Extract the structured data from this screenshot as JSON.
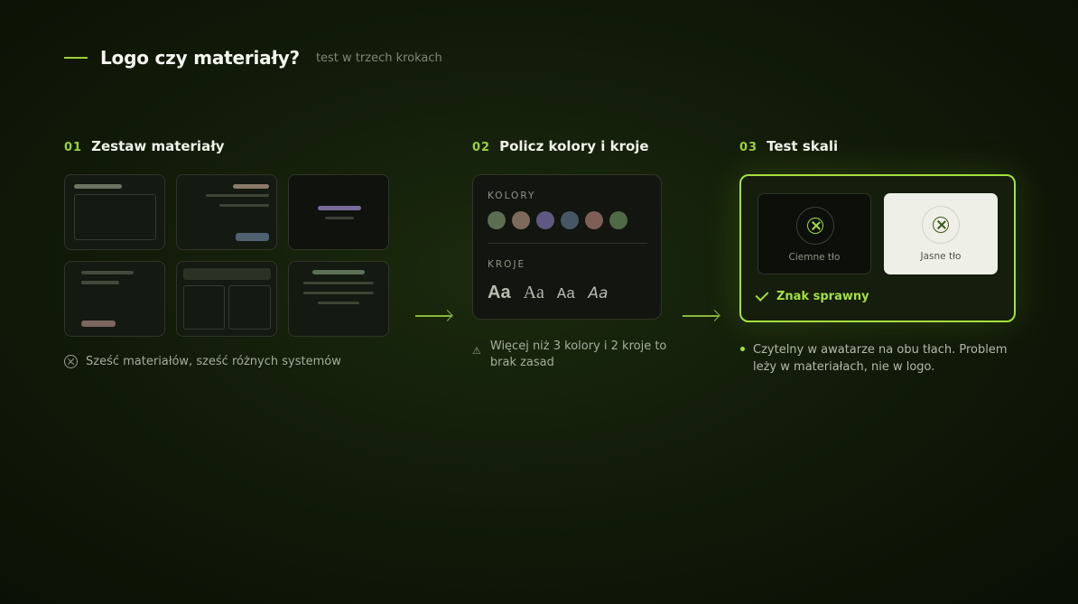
{
  "header": {
    "title": "Logo czy materiały?",
    "subtitle": "test w trzech krokach"
  },
  "steps": [
    {
      "num": "01",
      "title": "Zestaw materiały",
      "note": "Sześć materiałów, sześć różnych systemów"
    },
    {
      "num": "02",
      "title": "Policz kolory i kroje",
      "note": "Więcej niż 3 kolory i 2 kroje to brak zasad"
    },
    {
      "num": "03",
      "title": "Test skali",
      "note": "Czytelny w awatarze na obu tłach. Problem leży w materiałach, nie w logo."
    }
  ],
  "colors_card": {
    "colors_label": "KOLORY",
    "swatches": [
      "#5c6e50",
      "#7e6a5a",
      "#5f5880",
      "#465665",
      "#7d5f56",
      "#4f6a45"
    ],
    "fonts_label": "KROJE",
    "font_samples": [
      "Aa",
      "Aa",
      "Aa",
      "Aa"
    ]
  },
  "scale_card": {
    "dark_label": "Ciemne tło",
    "light_label": "Jasne tło",
    "result": "Znak sprawny",
    "accent": "#a4e03d"
  },
  "icons": [
    "x-circle-icon",
    "warning-icon",
    "check-icon",
    "bullet-icon",
    "arrow-right-icon"
  ]
}
